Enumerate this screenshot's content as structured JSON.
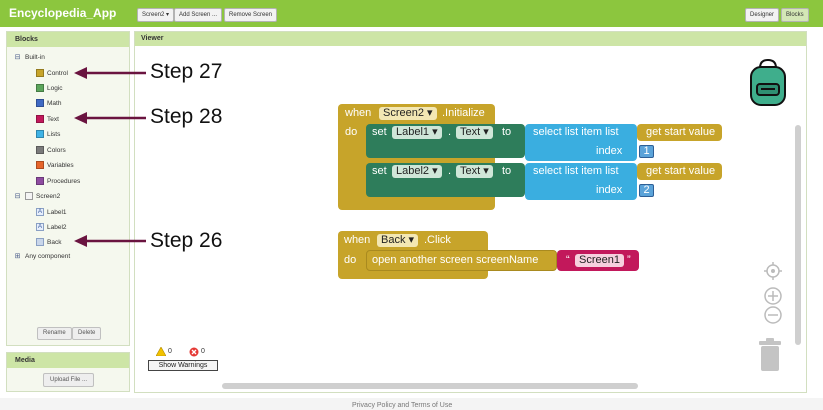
{
  "header": {
    "app_title": "Encyclopedia_App",
    "screen_select": "Screen2 ▾",
    "add_screen": "Add Screen ...",
    "remove_screen": "Remove Screen",
    "designer": "Designer",
    "blocks": "Blocks"
  },
  "blocks_panel": {
    "title": "Blocks",
    "builtin": "Built-in",
    "items": [
      {
        "label": "Control",
        "color": "#c7a42a"
      },
      {
        "label": "Logic",
        "color": "#5ba55b"
      },
      {
        "label": "Math",
        "color": "#3f6ac4"
      },
      {
        "label": "Text",
        "color": "#c2185b"
      },
      {
        "label": "Lists",
        "color": "#3fb3e6"
      },
      {
        "label": "Colors",
        "color": "#7a7a7a"
      },
      {
        "label": "Variables",
        "color": "#e6652a"
      },
      {
        "label": "Procedures",
        "color": "#8e4ba0"
      }
    ],
    "screen": "Screen2",
    "components": [
      "Label1",
      "Label2",
      "Back"
    ],
    "any_component": "Any component",
    "rename": "Rename",
    "delete": "Delete"
  },
  "media": {
    "title": "Media",
    "upload": "Upload File ..."
  },
  "viewer": {
    "title": "Viewer"
  },
  "annotations": {
    "step27": "Step 27",
    "step28": "Step 28",
    "step26": "Step 26"
  },
  "block_init": {
    "when": "when",
    "screen": "Screen2 ▾",
    "event": ".Initialize",
    "do": "do",
    "set": "set",
    "to": "to",
    "label1": "Label1 ▾",
    "label2": "Label2 ▾",
    "prop": "Text ▾",
    "dot": ".",
    "select": "select list item  list",
    "index": "index",
    "get": "get start value",
    "n1": "1",
    "n2": "2"
  },
  "block_click": {
    "when": "when",
    "comp": "Back ▾",
    "event": ".Click",
    "do": "do",
    "open": "open another screen  screenName",
    "quote_open": "“",
    "screen_text": "Screen1",
    "quote_close": "”"
  },
  "warnings": {
    "warn_count": "0",
    "error_count": "0",
    "show": "Show Warnings"
  },
  "footer": {
    "text": "Privacy Policy and Terms of Use"
  },
  "colors": {
    "control": "#c7a42a",
    "component": "#2e7d5b",
    "list": "#3aaee0",
    "text": "#c2185b"
  }
}
